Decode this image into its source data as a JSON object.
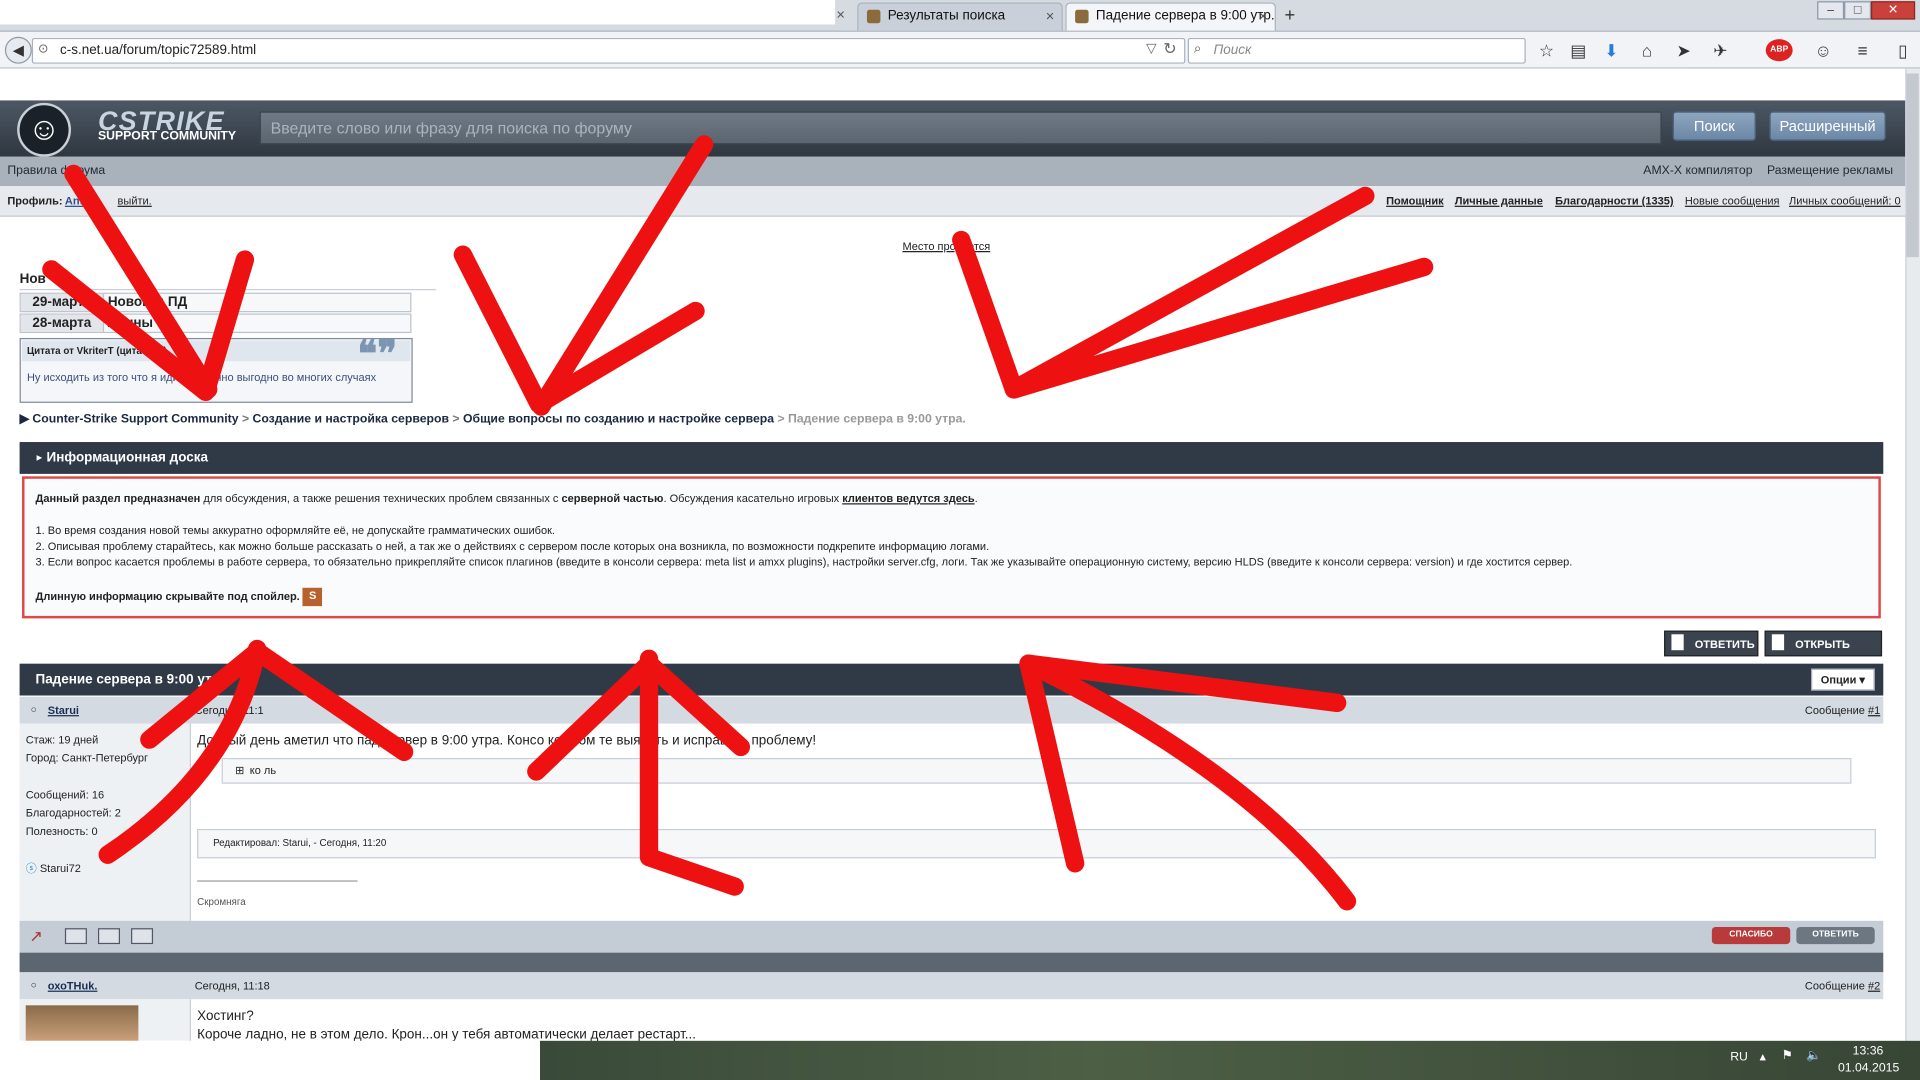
{
  "browser": {
    "tabs": [
      {
        "label": ""
      },
      {
        "label": ""
      },
      {
        "label": "Результаты поиска"
      },
      {
        "label": "Падение сервера в 9:00 утр..."
      }
    ],
    "url": "c-s.net.ua/forum/topic72589.html",
    "search_placeholder": "Поиск",
    "new_tab": "+",
    "close": "×"
  },
  "site": {
    "logo_title": "CSTRIKE",
    "logo_sub": "SUPPORT COMMUNITY",
    "search_placeholder": "Введите слово или фразу для поиска по форуму",
    "search_btn": "Поиск",
    "advanced_btn": "Расширенный",
    "nav_left": "Правила форума",
    "nav_right": [
      "AMX-X компилятор",
      "Размещение рекламы"
    ],
    "profile_label": "Профиль:",
    "profile_user": "Ant",
    "logout": "выйти.",
    "profile_links": [
      "Помощник",
      "Личные данные",
      "Благодарности (1335)",
      "Новые сообщения",
      "Личных сообщений: 0"
    ],
    "ad": "Место продается"
  },
  "news": {
    "title": "Нов",
    "items": [
      {
        "date": "29-марта",
        "text": "Новогод ПД"
      },
      {
        "date": "28-марта",
        "text": "Личны е"
      }
    ],
    "quote_head": "Цитата от VkriterT (цитатник)",
    "quote_body": "Ну исходить из того что я идиот конечно выгодно во многих случаях"
  },
  "breadcrumb": {
    "items": [
      "Counter-Strike Support Community",
      "Создание и настройка серверов",
      "Общие вопросы по созданию и настройке сервера"
    ],
    "current": "Падение сервера в 9:00 утра."
  },
  "info": {
    "title": "Информационная доска",
    "intro_bold": "Данный раздел предназначен",
    "intro_1": " для обсуждения, а также решения технических проблем связанных с ",
    "intro_bold2": "серверной частью",
    "intro_2": ". Обсуждения касательно игровых ",
    "intro_link": "клиентов ведутся здесь",
    "line1": "1. Во время создания новой темы аккуратно оформляйте её, не допускайте грамматических ошибок.",
    "line2": "2. Описывая проблему старайтесь, как можно больше рассказать о ней, а так же о действиях с сервером после которых она возникла, по возможности подкрепите информацию логами.",
    "line3": "3. Если вопрос касается проблемы в работе сервера, то обязательно прикрепляйте список плагинов (введите в консоли сервера: meta list и amxx plugins), настройки server.cfg, логи. Так же указывайте операционную систему, версию HLDS (введите к консоли сервера: version) и где хостится сервер.",
    "spoiler_note": "Длинную информацию скрывайте под спойлер."
  },
  "actions": {
    "reply": "ОТВЕТИТЬ",
    "new_topic": "ОТКРЫТЬ ТЕМУ"
  },
  "thread": {
    "title": "Падение сервера в 9:00 утр",
    "options": "Опции ▾",
    "posts": [
      {
        "user": "Starui",
        "time": "Сегодня, 11:1",
        "num_label": "Сообщение ",
        "num": "#1",
        "stats": [
          "Стаж: 19 дней",
          "Город: Санкт-Петербург",
          "",
          "Сообщений: 16",
          "Благодарностей: 2",
          "Полезность: 0"
        ],
        "skype": "Starui72",
        "text": "Добрый день аметил что пад сервер в 9:00 утра. Консо ке. Пом те выявить и исправить проблему!",
        "spoiler": "ко ль",
        "edited": "Редактировал: Starui, - Сегодня, 11:20",
        "signature": "Скромняга",
        "thanks": "СПАСИБО",
        "reply": "ОТВЕТИТЬ"
      },
      {
        "user": "охоTHuk.",
        "time": "Сегодня, 11:18",
        "num_label": "Сообщение ",
        "num": "#2",
        "text": "Хостинг?",
        "text2": "Короче ладно, не в этом дело. Крон...он у тебя автоматически делает рестарт..."
      }
    ]
  },
  "taskbar": {
    "lang": "RU",
    "time": "13:36",
    "date": "01.04.2015"
  },
  "colors": {
    "annotation": "#ee1111",
    "header": "#2f3a46",
    "info_border": "#e04848"
  }
}
